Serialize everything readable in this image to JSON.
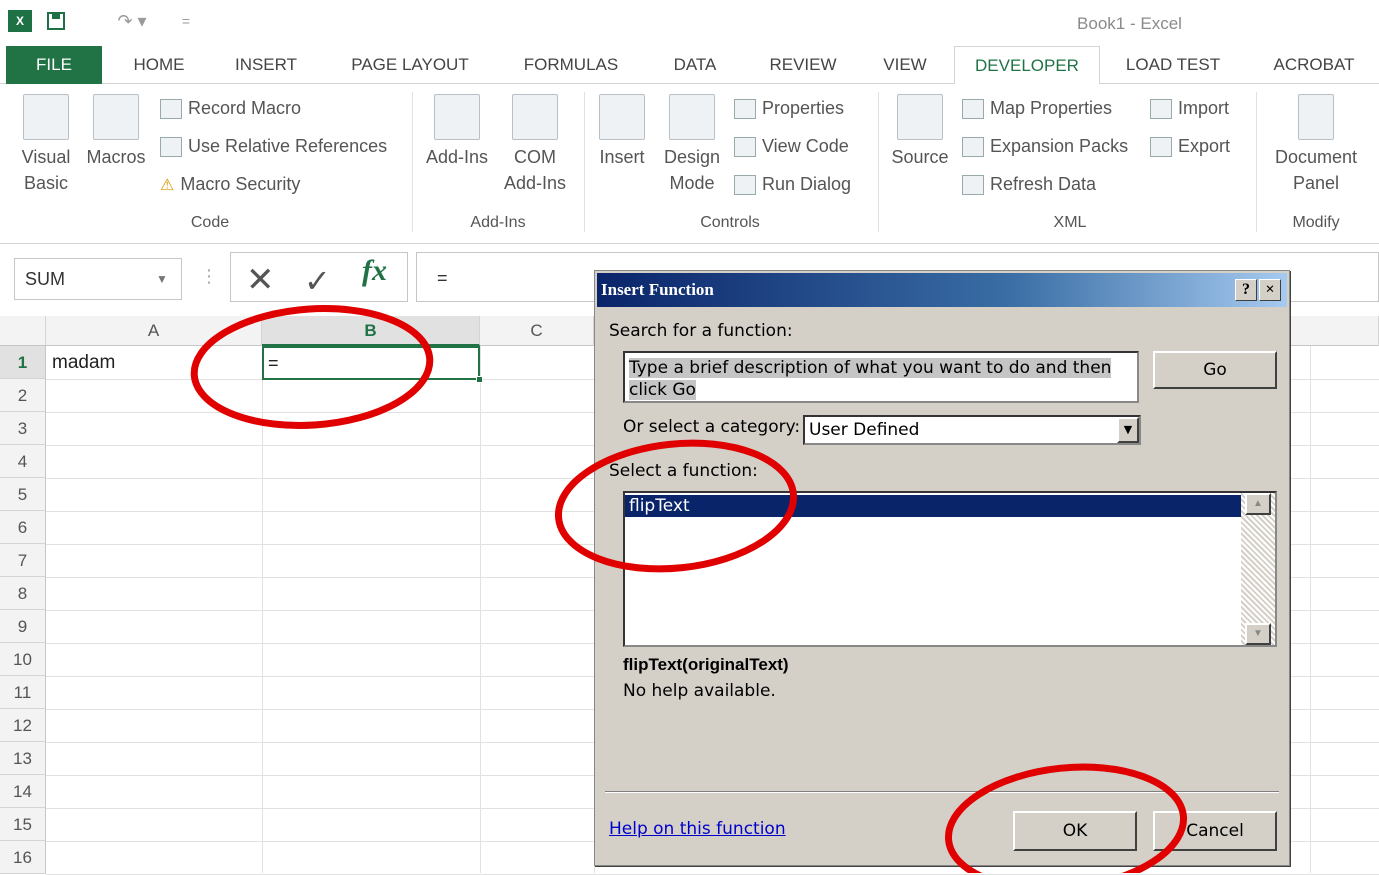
{
  "window": {
    "title": "Book1 - Excel",
    "logo_text": "X",
    "qat_redo": "↷ ▾",
    "qat_more": "="
  },
  "tabs": [
    {
      "label": "FILE"
    },
    {
      "label": "HOME"
    },
    {
      "label": "INSERT"
    },
    {
      "label": "PAGE LAYOUT"
    },
    {
      "label": "FORMULAS"
    },
    {
      "label": "DATA"
    },
    {
      "label": "REVIEW"
    },
    {
      "label": "VIEW"
    },
    {
      "label": "DEVELOPER"
    },
    {
      "label": "LOAD TEST"
    },
    {
      "label": "ACROBAT"
    }
  ],
  "ribbon": {
    "code": {
      "label": "Code",
      "visual_basic": "Visual Basic",
      "macros": "Macros",
      "record_macro": "Record Macro",
      "use_relative": "Use Relative References",
      "macro_security": "Macro Security"
    },
    "addins": {
      "label": "Add-Ins",
      "add_ins": "Add-Ins",
      "com_addins": "COM Add-Ins"
    },
    "controls": {
      "label": "Controls",
      "insert": "Insert",
      "design_mode": "Design Mode",
      "properties": "Properties",
      "view_code": "View Code",
      "run_dialog": "Run Dialog"
    },
    "xml": {
      "label": "XML",
      "source": "Source",
      "map_properties": "Map Properties",
      "expansion_packs": "Expansion Packs",
      "refresh_data": "Refresh Data",
      "import": "Import",
      "export": "Export"
    },
    "modify": {
      "label": "Modify",
      "document_panel": "Document Panel"
    }
  },
  "formula_bar": {
    "name_box": "SUM",
    "formula": "=",
    "fx": "fx"
  },
  "grid": {
    "columns": [
      "A",
      "B",
      "C"
    ],
    "selected_column": "B",
    "rows": [
      "1",
      "2",
      "3",
      "4",
      "5",
      "6",
      "7",
      "8",
      "9",
      "10",
      "11",
      "12",
      "13",
      "14",
      "15",
      "16"
    ],
    "cell_A1": "madam",
    "cell_B1": "="
  },
  "dialog": {
    "title": "Insert Function",
    "help_btn": "?",
    "close_btn": "×",
    "search_label": "Search for a function:",
    "search_value": "Type a brief description of what you want to do and then click Go",
    "go_label": "Go",
    "category_label": "Or select a category:",
    "category_value": "User Defined",
    "select_label": "Select a function:",
    "functions": [
      "flipText"
    ],
    "signature": "flipText(originalText)",
    "help_text": "No help available.",
    "help_link": "Help on this function",
    "ok_label": "OK",
    "cancel_label": "Cancel"
  },
  "colors": {
    "excel_green": "#217346",
    "dialog_bg": "#d4d0c8",
    "title_blue": "#0a246a",
    "annotation_red": "#e00000"
  }
}
